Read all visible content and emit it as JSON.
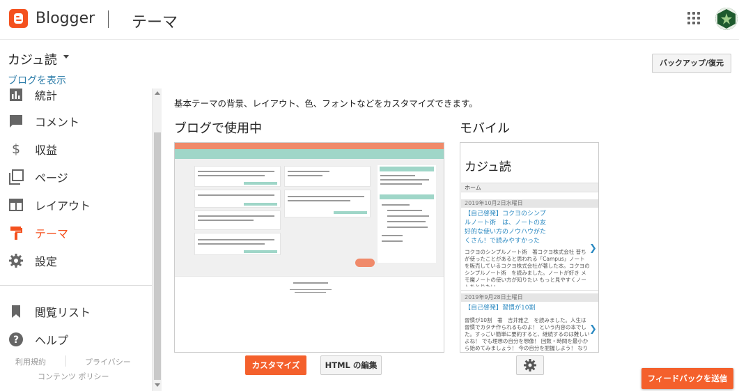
{
  "app": {
    "brand": "Blogger",
    "section": "テーマ"
  },
  "blog": {
    "name": "カジュ読",
    "view_link": "ブログを表示"
  },
  "toolbar": {
    "backup_label": "バックアップ/復元"
  },
  "sidebar": {
    "items": [
      {
        "label": "統計",
        "icon": "bar-chart-icon"
      },
      {
        "label": "コメント",
        "icon": "comment-icon"
      },
      {
        "label": "収益",
        "icon": "dollar-icon"
      },
      {
        "label": "ページ",
        "icon": "pages-icon"
      },
      {
        "label": "レイアウト",
        "icon": "layout-icon"
      },
      {
        "label": "テーマ",
        "icon": "theme-roller-icon",
        "active": true
      },
      {
        "label": "設定",
        "icon": "gear-icon"
      }
    ],
    "secondary": [
      {
        "label": "閲覧リスト",
        "icon": "bookmark-icon"
      },
      {
        "label": "ヘルプ",
        "icon": "help-icon"
      }
    ],
    "footer": {
      "terms": "利用規約",
      "privacy": "プライバシー",
      "content_policy": "コンテンツ ポリシー"
    }
  },
  "main": {
    "description": "基本テーマの背景、レイアウト、色、フォントなどをカスタマイズできます。",
    "used_heading": "ブログで使用中",
    "mobile_heading": "モバイル",
    "customize_label": "カスタマイズ",
    "html_edit_label": "HTML の編集"
  },
  "mobile_preview": {
    "title": "カジュ読",
    "home": "ホーム",
    "posts": [
      {
        "date": "2019年10月2日水曜日",
        "title_lines": [
          "【自己啓発】コクヨのシンプ",
          "ルノート術　は、ノートの友",
          "好的な使い方のノウハウがた",
          "くさん！で読みやすかった"
        ],
        "excerpt": "コクヨのシンプルノート術　著コクヨ株式会社 普ちが使ったことがあると思われる「Campus」ノートを販売しているコクヨ株式会社が著した本。コクヨのシンプルノート術　を読みました。ノートが好き メモ魔ノートの使い方が知りたい もっと見やすくノートをとりたい…"
      },
      {
        "date": "2019年9月28日土曜日",
        "title_lines": [
          "【自己啓発】習慣が10割"
        ],
        "excerpt": "習慣が10割　著　吉井雅之　を読みました。人生は習慣でカタチ作られるものよ！ という内容の本でした。すっごい簡単に要約すると、継続するのは難しいよね！ でも理想の自分を想像！ 回数・時間を最小から始めてみましょう！ 今の自分を肥握しよう！ なりたい自分を想像"
      }
    ]
  },
  "feedback_label": "フィードバックを送信",
  "colors": {
    "accent": "#f4511e",
    "link": "#2a7ba8",
    "teal": "#9fd6c8"
  }
}
